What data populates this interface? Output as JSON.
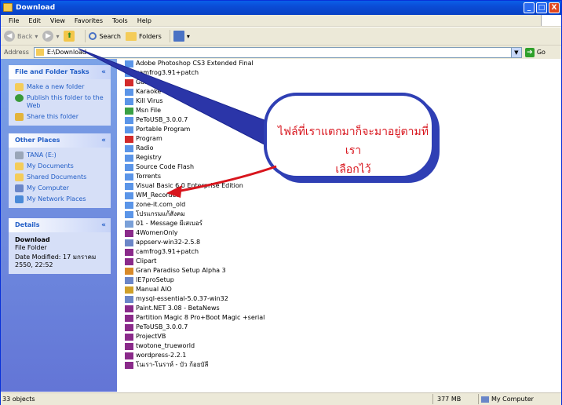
{
  "window": {
    "title": "Download",
    "buttons": [
      "_",
      "□",
      "X"
    ]
  },
  "menu": [
    "File",
    "Edit",
    "View",
    "Favorites",
    "Tools",
    "Help"
  ],
  "toolbar": {
    "back": "Back",
    "search": "Search",
    "folders": "Folders"
  },
  "address": {
    "label": "Address",
    "value": "E:\\Download",
    "go": "Go"
  },
  "sidebar": {
    "tasks": {
      "title": "File and Folder Tasks",
      "items": [
        "Make a new folder",
        "Publish this folder to the Web",
        "Share this folder"
      ]
    },
    "places": {
      "title": "Other Places",
      "items": [
        "TANA (E:)",
        "My Documents",
        "Shared Documents",
        "My Computer",
        "My Network Places"
      ]
    },
    "details": {
      "title": "Details",
      "name": "Download",
      "type": "File Folder",
      "modified": "Date Modified: 17 มกราคม 2550, 22:52"
    }
  },
  "files": [
    {
      "name": "Adobe Photoshop CS3 Extended Final",
      "color": "#5b95e8"
    },
    {
      "name": "camfrog3.91+patch",
      "color": "#5b95e8"
    },
    {
      "name": "Game",
      "color": "#d22a2a"
    },
    {
      "name": "Karaoke",
      "color": "#5b95e8"
    },
    {
      "name": "Kill Virus",
      "color": "#5b95e8"
    },
    {
      "name": "Msn File",
      "color": "#3aa044"
    },
    {
      "name": "PeToUSB_3.0.0.7",
      "color": "#5b95e8"
    },
    {
      "name": "Portable Program",
      "color": "#5b95e8"
    },
    {
      "name": "Program",
      "color": "#d22a2a"
    },
    {
      "name": "Radio",
      "color": "#5b95e8"
    },
    {
      "name": "Registry",
      "color": "#5b95e8"
    },
    {
      "name": "Source Code  Flash",
      "color": "#5b95e8"
    },
    {
      "name": "Torrents",
      "color": "#5b95e8"
    },
    {
      "name": "Visual Basic 6.0 Enterprise Edition",
      "color": "#5b95e8"
    },
    {
      "name": "WM_Recorder",
      "color": "#5b95e8"
    },
    {
      "name": "zone-it.com_old",
      "color": "#5b95e8"
    },
    {
      "name": "โปรแกรมแก้สังคม",
      "color": "#5b95e8"
    },
    {
      "name": "01 - Message ผีเสเบอร์",
      "color": "#7aa0d8"
    },
    {
      "name": "4WomenOnly",
      "color": "#8a2a8a"
    },
    {
      "name": "appserv-win32-2.5.8",
      "color": "#6b86c8"
    },
    {
      "name": "camfrog3.91+patch",
      "color": "#8a2a8a"
    },
    {
      "name": "Clipart",
      "color": "#8a2a8a"
    },
    {
      "name": "Gran Paradiso Setup Alpha 3",
      "color": "#d88a2a"
    },
    {
      "name": "IE7proSetup",
      "color": "#6b86c8"
    },
    {
      "name": "Manual AIO",
      "color": "#cfa02a"
    },
    {
      "name": "mysql-essential-5.0.37-win32",
      "color": "#6b86c8"
    },
    {
      "name": "Paint.NET 3.08 - BetaNews",
      "color": "#8a2a8a"
    },
    {
      "name": "Partition Magic 8 Pro+Boot Magic +serial",
      "color": "#8a2a8a"
    },
    {
      "name": "PeToUSB_3.0.0.7",
      "color": "#8a2a8a"
    },
    {
      "name": "ProjectVB",
      "color": "#8a2a8a"
    },
    {
      "name": "twotone_trueworld",
      "color": "#8a2a8a"
    },
    {
      "name": "wordpress-2.2.1",
      "color": "#8a2a8a"
    },
    {
      "name": "โนเรา-โนราห์ - บัว ก้อยบัลี",
      "color": "#8a2a8a"
    }
  ],
  "callout": {
    "line1": "ไฟล์ที่เราแตกมาก็จะมาอยู่ตามที่เรา",
    "line2": "เลือกไว้"
  },
  "status": {
    "objects": "33 objects",
    "size": "377 MB",
    "location": "My Computer"
  }
}
